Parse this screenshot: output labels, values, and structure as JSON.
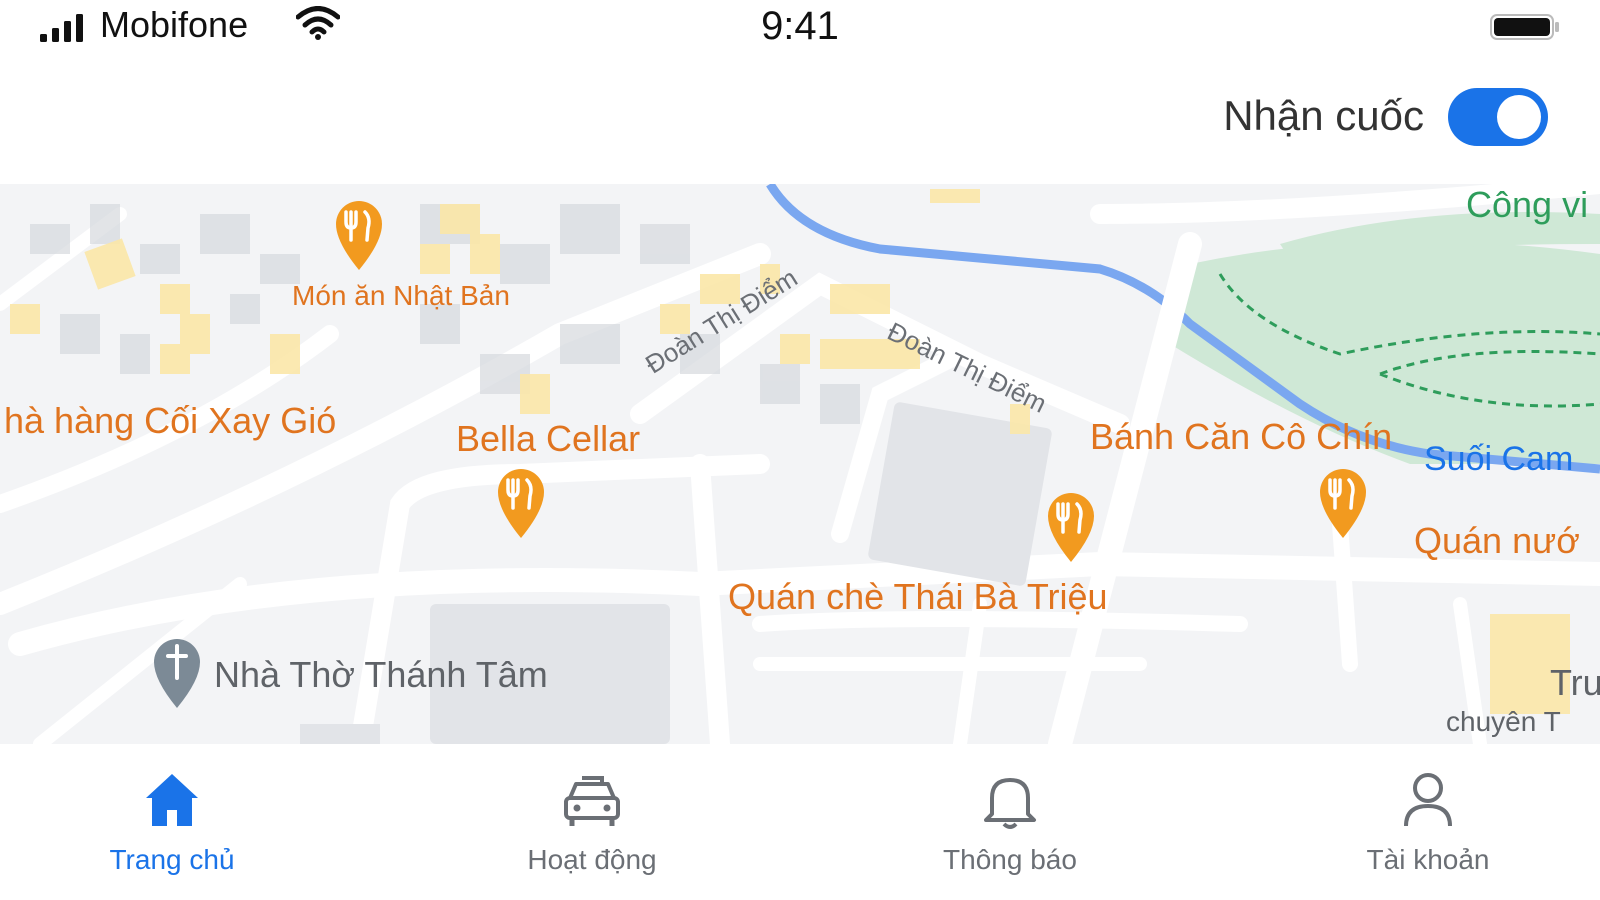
{
  "status_bar": {
    "carrier": "Mobifone",
    "time": "9:41"
  },
  "header": {
    "toggle_label": "Nhận cuốc",
    "toggle_on": true
  },
  "map": {
    "places": {
      "mon_an": "Món ăn Nhật Bản",
      "coi_xay_gio": "hà hàng Cối Xay Gió",
      "bella_cellar": "Bella Cellar",
      "banh_can": "Bánh Căn Cô Chín",
      "quan_nuoc": "Quán nướ",
      "quan_che": "Quán chè Thái Bà Triệu",
      "nha_tho": "Nhà Thờ Thánh Tâm",
      "suoi_cam": "Suối Cam",
      "cong_vien": "Công vi",
      "tru": "Tru",
      "chuyen": "chuyên T"
    },
    "streets": {
      "street_1": "Đoàn Thị Điểm",
      "street_2": "Đoàn Thị Điểm"
    }
  },
  "nav": {
    "items": [
      {
        "label": "Trang chủ",
        "icon": "home-icon",
        "active": true
      },
      {
        "label": "Hoạt động",
        "icon": "car-icon",
        "active": false
      },
      {
        "label": "Thông báo",
        "icon": "bell-icon",
        "active": false
      },
      {
        "label": "Tài khoản",
        "icon": "user-icon",
        "active": false
      }
    ]
  },
  "colors": {
    "accent": "#1a73e8",
    "poi": "#e0741f",
    "park": "#cfe8d6",
    "river": "#7aa7f0"
  }
}
